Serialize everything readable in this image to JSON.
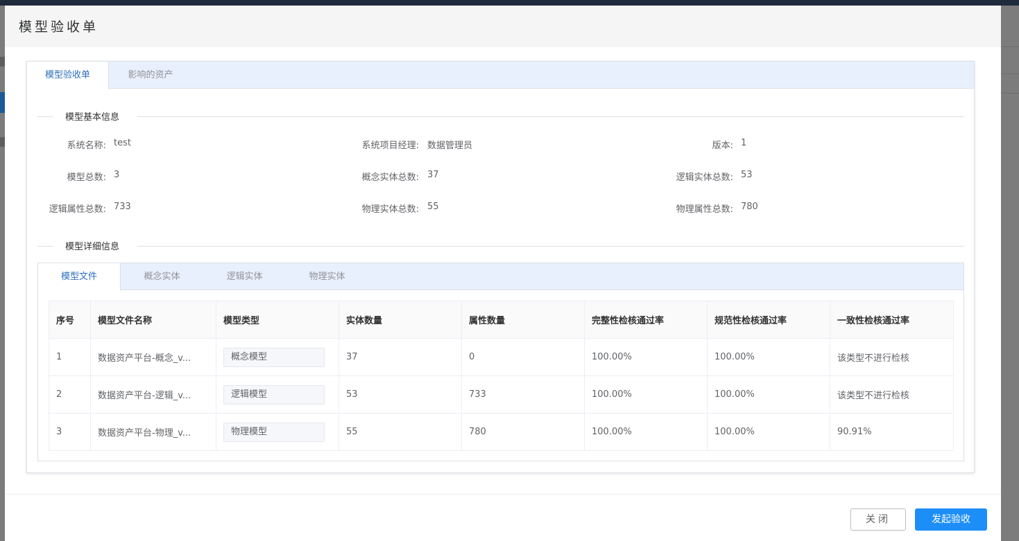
{
  "dialog": {
    "title": "模型验收单",
    "tabs": [
      {
        "label": "模型验收单"
      },
      {
        "label": "影响的资产"
      }
    ],
    "basic_section_title": "模型基本信息",
    "basic_info": {
      "system_name_label": "系统名称:",
      "system_name_value": "test",
      "manager_label": "系统项目经理:",
      "manager_value": "数据管理员",
      "version_label": "版本:",
      "version_value": "1",
      "model_total_label": "模型总数:",
      "model_total_value": "3",
      "concept_total_label": "概念实体总数:",
      "concept_total_value": "37",
      "logic_total_label": "逻辑实体总数:",
      "logic_total_value": "53",
      "logic_attr_label": "逻辑属性总数:",
      "logic_attr_value": "733",
      "physical_total_label": "物理实体总数:",
      "physical_total_value": "55",
      "physical_attr_label": "物理属性总数:",
      "physical_attr_value": "780"
    },
    "detail_section_title": "模型详细信息",
    "detail_tabs": [
      {
        "label": "模型文件"
      },
      {
        "label": "概念实体"
      },
      {
        "label": "逻辑实体"
      },
      {
        "label": "物理实体"
      }
    ],
    "table": {
      "headers": [
        "序号",
        "模型文件名称",
        "模型类型",
        "实体数量",
        "属性数量",
        "完整性检核通过率",
        "规范性检核通过率",
        "一致性检核通过率"
      ],
      "rows": [
        [
          "1",
          "数据资产平台-概念_v...",
          "概念模型",
          "37",
          "0",
          "100.00%",
          "100.00%",
          "该类型不进行检核"
        ],
        [
          "2",
          "数据资产平台-逻辑_v...",
          "逻辑模型",
          "53",
          "733",
          "100.00%",
          "100.00%",
          "该类型不进行检核"
        ],
        [
          "3",
          "数据资产平台-物理_v...",
          "物理模型",
          "55",
          "780",
          "100.00%",
          "100.00%",
          "90.91%"
        ]
      ]
    },
    "buttons": {
      "close": "关闭",
      "submit": "发起验收"
    }
  },
  "colors": {
    "accent": "#1d8ef7",
    "tab_active_text": "#2f6fbd",
    "tab_bar_bg": "#e9f0fd"
  }
}
